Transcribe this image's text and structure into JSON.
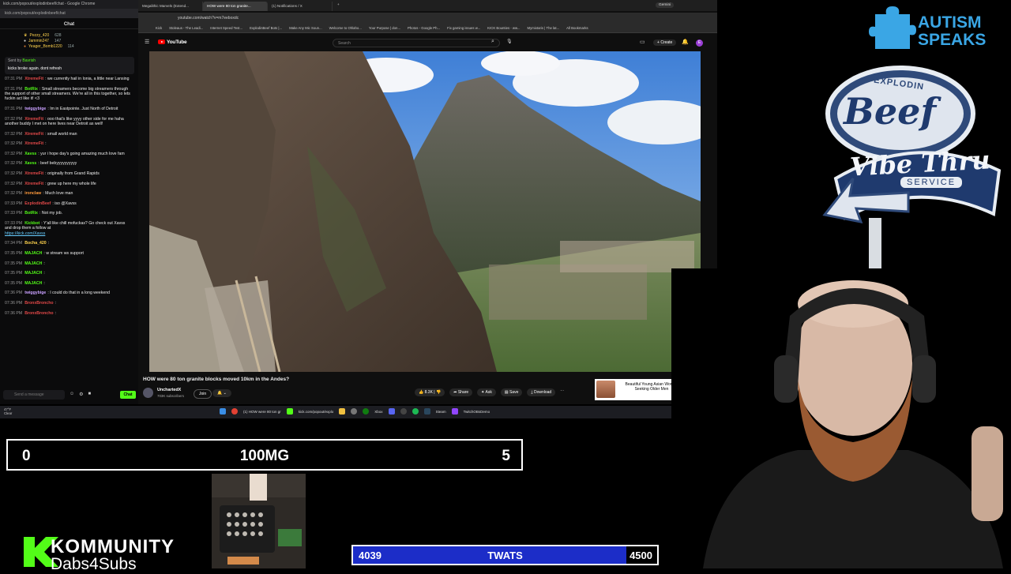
{
  "chat_window": {
    "title": "kick.com/popout/explodinbeef/chat - Google Chrome",
    "url": "kick.com/popout/explodinbeef/chat",
    "heading": "Chat",
    "leaderboard": [
      {
        "name": "Pezzy_420",
        "value": "628"
      },
      {
        "name": "Jammin247",
        "value": "147"
      },
      {
        "name": "Yeager_Bomb1220",
        "value": "114"
      }
    ],
    "pinned": {
      "by": "Sent by",
      "author": "Bavrish",
      "text": "kicks broke again. dont refresh"
    },
    "messages": [
      {
        "time": "07:31 PM",
        "user": "XtremeFit",
        "color": "#e04848",
        "text": "we currently hail in Ionia, a little near Lansing"
      },
      {
        "time": "07:31 PM",
        "user": "BotRix",
        "color": "#53fc18",
        "text": "Small streamers become big streamers through the support of other small streamers. We're all in this together, so lets fuckin act like it! <3"
      },
      {
        "time": "07:31 PM",
        "user": "twiggybige",
        "color": "#c9a0ff",
        "text": "Im in Eastpointe. Just North of Detroit"
      },
      {
        "time": "07:32 PM",
        "user": "XtremeFit",
        "color": "#e04848",
        "text": "ooo that's like yyyy other side for me haha another buddy I met on here lives near Detroit as well!"
      },
      {
        "time": "07:32 PM",
        "user": "XtremeFit",
        "color": "#e04848",
        "text": "small world man"
      },
      {
        "time": "07:32 PM",
        "user": "XtremeFit",
        "color": "#e04848",
        "text": ""
      },
      {
        "time": "07:32 PM",
        "user": "Xavss",
        "color": "#53fc18",
        "text": "yur i hope day's going amazing much love fam"
      },
      {
        "time": "07:32 PM",
        "user": "Xavss",
        "color": "#53fc18",
        "text": "beef bebyyyyyyyyyy"
      },
      {
        "time": "07:32 PM",
        "user": "XtremeFit",
        "color": "#e04848",
        "text": "originally from Grand Rapids"
      },
      {
        "time": "07:32 PM",
        "user": "XtremeFit",
        "color": "#e04848",
        "text": "grew up here my whole life"
      },
      {
        "time": "07:32 PM",
        "user": "ironclaw",
        "color": "#ff9a3c",
        "text": "Much love man"
      },
      {
        "time": "07:33 PM",
        "user": "ExplodinBeef",
        "color": "#e04848",
        "text": "iso @Xavss"
      },
      {
        "time": "07:33 PM",
        "user": "BotRix",
        "color": "#53fc18",
        "text": "Not my job."
      },
      {
        "time": "07:33 PM",
        "user": "Kickbot",
        "color": "#53fc18",
        "text": "Y'all like chill mofuckas? Go check out Xavss and drop them a follow at",
        "link": "https://kick.com/Xavss"
      },
      {
        "time": "07:34 PM",
        "user": "Bocha_420",
        "color": "#ffd34d",
        "text": ""
      },
      {
        "time": "07:35 PM",
        "user": "MAJACH",
        "color": "#53fc18",
        "text": "w stream ws support"
      },
      {
        "time": "07:35 PM",
        "user": "MAJACH",
        "color": "#53fc18",
        "text": ""
      },
      {
        "time": "07:35 PM",
        "user": "MAJACH",
        "color": "#53fc18",
        "text": ""
      },
      {
        "time": "07:35 PM",
        "user": "MAJACH",
        "color": "#53fc18",
        "text": ""
      },
      {
        "time": "07:36 PM",
        "user": "twiggybige",
        "color": "#c9a0ff",
        "text": "I could do that in a long weekend"
      },
      {
        "time": "07:36 PM",
        "user": "BronxBroncho",
        "color": "#e04848",
        "text": ""
      },
      {
        "time": "07:36 PM",
        "user": "BronxBroncho",
        "color": "#e04848",
        "text": ""
      }
    ],
    "input_placeholder": "Send a message",
    "send_label": "Chat"
  },
  "browser": {
    "tabs": [
      {
        "label": "Megalithic Marvels (Extend...",
        "active": false
      },
      {
        "label": "HOW were 80 ton granite...",
        "active": true
      },
      {
        "label": "(1) Notifications / X",
        "active": false
      }
    ],
    "gemini_label": "Gemini",
    "url": "youtube.com/watch?v=m7eeboxdc",
    "bookmarks": [
      "Kick",
      "Stoleaus - The Leadi...",
      "Internet Speed Test...",
      "ExplodinBeef Bots |...",
      "Make Any Mic Soun...",
      "Welcome to Ohlaho...",
      "Your Purpose | don...",
      "Photos - Google Ph...",
      "Fix gaming issues w...",
      "KICK Bounties - ww...",
      "Mymixtaris | The lat...",
      "All Bookmarks"
    ]
  },
  "youtube": {
    "logo": "YouTube",
    "search_placeholder": "Search",
    "create_label": "Create",
    "avatar_letter": "E",
    "video_title": "HOW were 80 ton granite blocks moved 10km in the Andes?",
    "channel_name": "UnchartedX",
    "subscribers": "703K subscribers",
    "join_label": "Join",
    "subscribed_label": "🔔 ⌄",
    "likes": "8.3K",
    "actions": [
      "Share",
      "Ask",
      "Save",
      "Download"
    ],
    "ad_text": "Beautiful Young Asian Women Seeking Older Men"
  },
  "taskbar": {
    "weather_temp": "47°F",
    "weather_desc": "Clear",
    "items": [
      {
        "label": "(1) HOW were 80 ton gr",
        "color": "#4285f4"
      },
      {
        "label": "kick.com/popout/explo",
        "color": "#53fc18"
      },
      {
        "label": "Xbox",
        "color": "#107c10"
      },
      {
        "label": "Steam",
        "color": "#1b2838"
      },
      {
        "label": "TwitchOBsDemo",
        "color": "#9146ff"
      }
    ],
    "time": "7:37 PM",
    "date": "2/1/2026"
  },
  "overlay": {
    "score_left": "0",
    "score_title": "100MG",
    "score_right": "5",
    "kommunity_title": "KOMMUNITY",
    "kommunity_sub": "Dabs4Subs",
    "goal_current": "4039",
    "goal_label": "TWATS",
    "goal_max": "4500",
    "goal_fraction": 0.8976,
    "autism_line1": "AUTISM",
    "autism_line2": "SPEAKS",
    "sign_top": "EXPLODIN",
    "sign_beef": "Beef",
    "sign_vibe": "Vibe Thru",
    "sign_service": "SERVICE"
  },
  "colors": {
    "kick_green": "#53fc18",
    "youtube_red": "#ff0000",
    "goal_blue": "#1c2dc8",
    "autism_blue": "#3aa6e5"
  }
}
